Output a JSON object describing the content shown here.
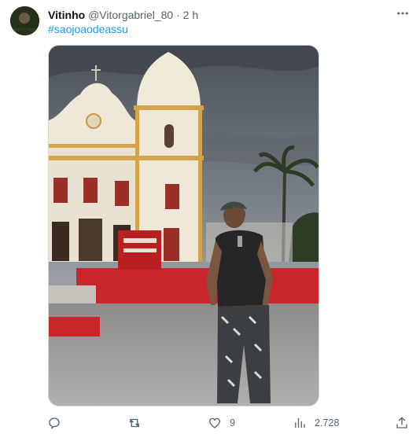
{
  "tweet": {
    "author_name": "Vitinho",
    "author_handle": "@Vitorgabriel_80",
    "separator": "·",
    "time": "2 h",
    "text": "#saojoaodeassu"
  },
  "icons": {
    "more": "more-horizontal-icon",
    "reply": "reply-icon",
    "retweet": "retweet-icon",
    "like": "heart-icon",
    "views": "views-bar-chart-icon",
    "share": "share-icon"
  },
  "actions": {
    "reply_count": "",
    "retweet_count": "",
    "like_count": "9",
    "views_count": "2.728"
  },
  "colors": {
    "link": "#1d9bf0",
    "secondary_text": "#536471",
    "primary_text": "#0f1419"
  }
}
